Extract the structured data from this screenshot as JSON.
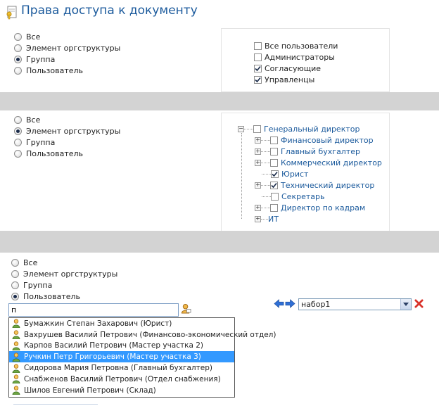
{
  "header": {
    "title": "Права доступа к документу"
  },
  "section1": {
    "radios": [
      {
        "label": "Все",
        "checked": false
      },
      {
        "label": "Элемент оргструктуры",
        "checked": false
      },
      {
        "label": "Группа",
        "checked": true
      },
      {
        "label": "Пользователь",
        "checked": false
      }
    ],
    "groups": [
      {
        "label": "Все пользователи",
        "checked": false
      },
      {
        "label": "Администраторы",
        "checked": false
      },
      {
        "label": "Согласующие",
        "checked": true
      },
      {
        "label": "Управленцы",
        "checked": true
      }
    ]
  },
  "section2": {
    "radios": [
      {
        "label": "Все",
        "checked": false
      },
      {
        "label": "Элемент оргструктуры",
        "checked": true
      },
      {
        "label": "Группа",
        "checked": false
      },
      {
        "label": "Пользователь",
        "checked": false
      }
    ],
    "tree": {
      "root": {
        "label": "Генеральный директор",
        "checked": false,
        "expand": "−"
      },
      "children": [
        {
          "label": "Финансовый директор",
          "checked": false,
          "expandable": true
        },
        {
          "label": "Главный бухгалтер",
          "checked": false,
          "expandable": true
        },
        {
          "label": "Коммерческий директор",
          "checked": false,
          "expandable": true
        },
        {
          "label": "Юрист",
          "checked": true,
          "expandable": false
        },
        {
          "label": "Технический директор",
          "checked": true,
          "expandable": true
        },
        {
          "label": "Секретарь",
          "checked": false,
          "expandable": false
        },
        {
          "label": "Директор по кадрам",
          "checked": false,
          "expandable": true
        }
      ],
      "next_root": {
        "label": "ИТ"
      }
    }
  },
  "section3": {
    "radios": [
      {
        "label": "Все",
        "checked": false
      },
      {
        "label": "Элемент оргструктуры",
        "checked": false
      },
      {
        "label": "Группа",
        "checked": false
      },
      {
        "label": "Пользователь",
        "checked": true
      }
    ],
    "search": {
      "value": "п"
    },
    "suggestions": [
      "Бумажкин Степан Захарович (Юрист)",
      "Вахрушев Василий Петрович (Финансово-экономический отдел)",
      "Карпов Василий Петрович (Мастер участка 2)",
      "Ручкин Петр Григорьевич (Мастер участка 3)",
      "Сидорова Мария Петровна (Главный бухгалтер)",
      "Снабженов Василий Петрович (Отдел снабжения)",
      "Шилов Евгений Петрович (Склад)"
    ],
    "selected_index": 3,
    "set_select": {
      "value": "набор1"
    }
  },
  "colors": {
    "title": "#1b5a9c",
    "separator": "#d3d3d3",
    "highlight": "#3399ff",
    "arrow_blue": "#2f6fd6",
    "delete_red": "#d9332b"
  }
}
